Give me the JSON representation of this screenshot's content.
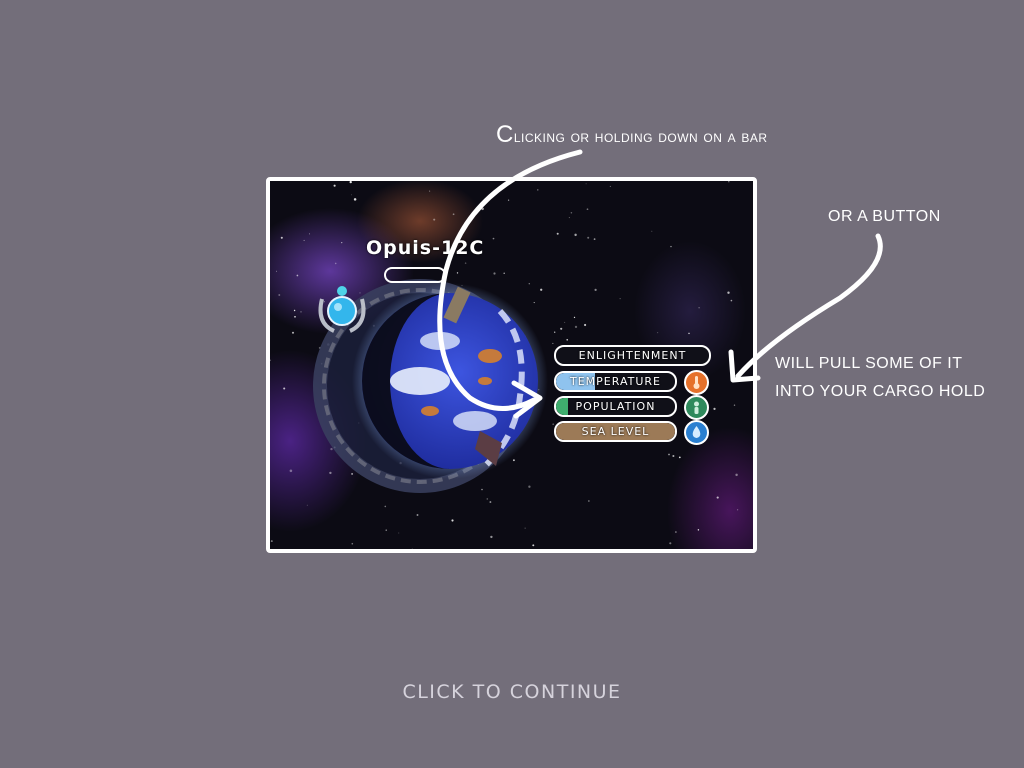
{
  "tutorial": {
    "note_clicking_first": "C",
    "note_clicking_rest": "licking or holding down on a bar",
    "note_button": "OR A BUTTON",
    "note_pull_line1": "WILL PULL SOME OF IT",
    "note_pull_line2": "INTO YOUR CARGO HOLD"
  },
  "planet": {
    "name": "Opuis-12C"
  },
  "stats": [
    {
      "label": "ENLIGHTENMENT",
      "level": 0.0,
      "color": "#ffffff",
      "has_button": false
    },
    {
      "label": "TEMPERATURE",
      "level": 0.33,
      "color": "#8fc3ee",
      "has_button": true,
      "button_color": "#e5712b",
      "button_icon": "thermometer-icon"
    },
    {
      "label": "POPULATION",
      "level": 0.1,
      "color": "#3fae6e",
      "has_button": true,
      "button_color": "#2f8a5c",
      "button_icon": "person-icon"
    },
    {
      "label": "SEA LEVEL",
      "level": 1.0,
      "color": "#9c7a57",
      "has_button": true,
      "button_color": "#2a7fd0",
      "button_icon": "drop-icon"
    }
  ],
  "footer": {
    "continue": "CLICK TO CONTINUE"
  },
  "colors": {
    "background": "#736e7a",
    "frame_border": "#ffffff",
    "space": "#0c0b14",
    "ocean": "#2c3fc0"
  }
}
